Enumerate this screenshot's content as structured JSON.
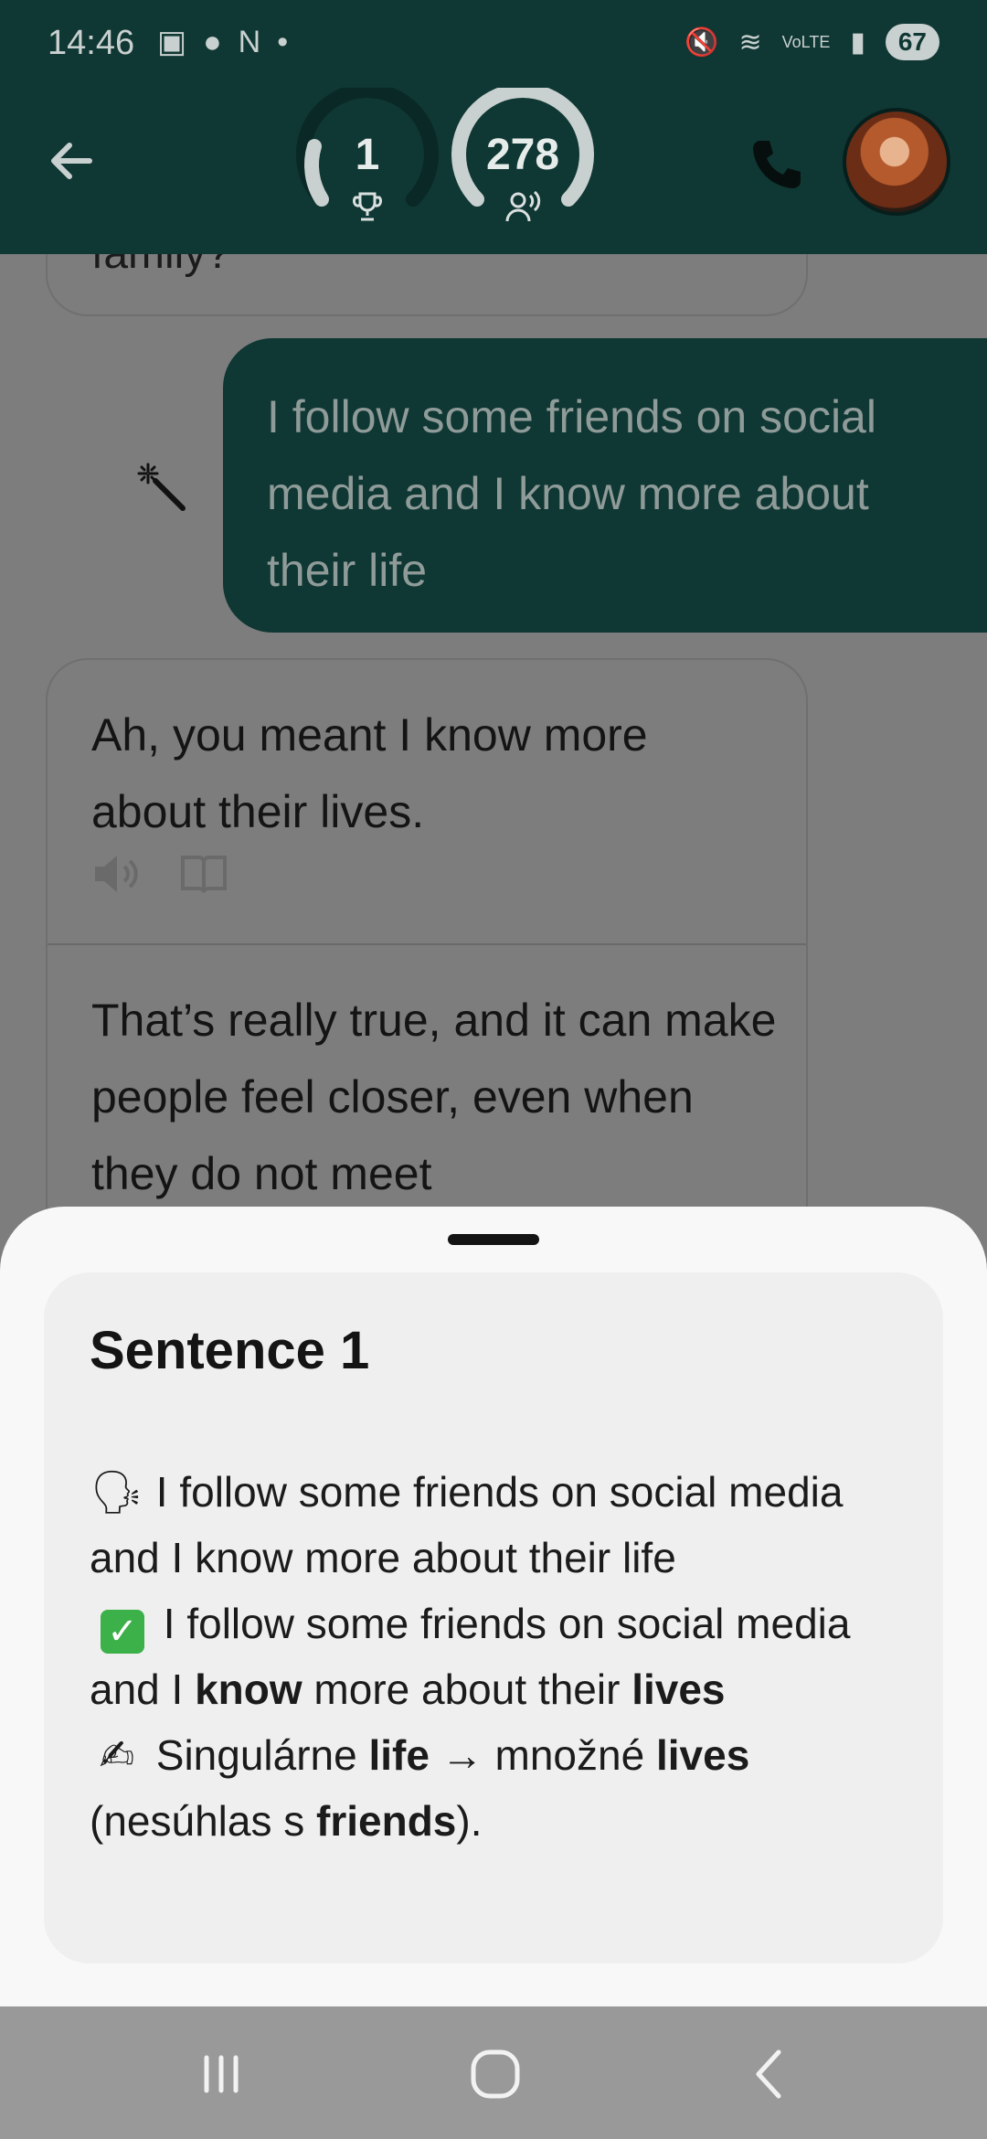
{
  "status_bar": {
    "time": "14:46",
    "battery": "67"
  },
  "header": {
    "score_trophy": "1",
    "score_listeners": "278"
  },
  "chat": {
    "previous_bubble_tail": "family?",
    "user_message": "I follow some friends on social media and I know more about their life",
    "ai_message_part1": "Ah, you meant I know more about their lives.",
    "ai_message_part2": "That’s really true, and it can make people feel closer, even when they do not meet"
  },
  "sheet": {
    "title": "Sentence 1",
    "original_line": "I follow some friends on social media and I know more about their life",
    "corrected_prefix": "I follow some friends on social media and I ",
    "corrected_bold1": "know",
    "corrected_mid": " more about their ",
    "corrected_bold2": "lives",
    "note_prefix": " Singulárne ",
    "note_bold1": "life",
    "note_mid": " → množné ",
    "note_bold2": "lives",
    "note_line2_prefix": "(nesúhlas s ",
    "note_bold3": "friends",
    "note_line2_suffix": ")."
  },
  "icons": [
    "back-arrow-icon",
    "trophy-icon",
    "listener-icon",
    "phone-icon",
    "magic-wand-icon",
    "speaker-icon",
    "book-icon",
    "speaking-head-icon",
    "check-mark-icon",
    "writing-hand-icon",
    "recent-apps-icon",
    "home-icon",
    "nav-back-icon"
  ],
  "colors": {
    "header_bg": "#0f3733",
    "user_bubble_bg": "#0f3733",
    "sheet_bg": "#f8f8f8",
    "card_bg": "#efefef",
    "check_green": "#3cb049"
  }
}
